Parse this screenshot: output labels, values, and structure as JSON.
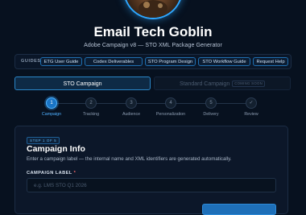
{
  "header": {
    "title": "Email Tech Goblin",
    "subtitle": "Adobe Campaign v8 — STO XML Package Generator"
  },
  "guides": {
    "label": "GUIDES",
    "links": [
      "ETG User Guide",
      "Codex Deliverables",
      "STO Program Design",
      "STO Workflow Guide",
      "Request Help"
    ]
  },
  "tabs": {
    "active": "STO Campaign",
    "disabled": "Standard Campaign",
    "disabled_badge": "COMING SOON"
  },
  "steps": [
    {
      "number": "1",
      "label": "Campaign"
    },
    {
      "number": "2",
      "label": "Tracking"
    },
    {
      "number": "3",
      "label": "Audience"
    },
    {
      "number": "4",
      "label": "Personalization"
    },
    {
      "number": "5",
      "label": "Delivery"
    },
    {
      "number": "✓",
      "label": "Review"
    }
  ],
  "current_step": 1,
  "panel": {
    "step_tag": "STEP 1 OF 5",
    "title": "Campaign Info",
    "description": "Enter a campaign label — the internal name and XML identifiers are generated automatically.",
    "field_label": "CAMPAIGN LABEL",
    "required_mark": "*",
    "field_placeholder": "e.g. LMS STO Q1 2026",
    "field_value": ""
  },
  "colors": {
    "background": "#07111f",
    "accent": "#2ea7ff",
    "active_step": "#1a75c5",
    "panel": "#0c1729"
  },
  "icons": {
    "avatar": "goblin-avatar-image",
    "final_step": "checkmark-icon"
  }
}
